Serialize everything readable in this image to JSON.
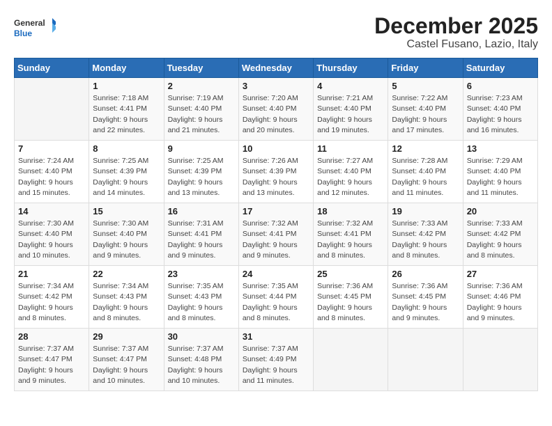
{
  "header": {
    "logo_general": "General",
    "logo_blue": "Blue",
    "month": "December 2025",
    "location": "Castel Fusano, Lazio, Italy"
  },
  "days_of_week": [
    "Sunday",
    "Monday",
    "Tuesday",
    "Wednesday",
    "Thursday",
    "Friday",
    "Saturday"
  ],
  "weeks": [
    [
      {
        "day": "",
        "info": ""
      },
      {
        "day": "1",
        "info": "Sunrise: 7:18 AM\nSunset: 4:41 PM\nDaylight: 9 hours\nand 22 minutes."
      },
      {
        "day": "2",
        "info": "Sunrise: 7:19 AM\nSunset: 4:40 PM\nDaylight: 9 hours\nand 21 minutes."
      },
      {
        "day": "3",
        "info": "Sunrise: 7:20 AM\nSunset: 4:40 PM\nDaylight: 9 hours\nand 20 minutes."
      },
      {
        "day": "4",
        "info": "Sunrise: 7:21 AM\nSunset: 4:40 PM\nDaylight: 9 hours\nand 19 minutes."
      },
      {
        "day": "5",
        "info": "Sunrise: 7:22 AM\nSunset: 4:40 PM\nDaylight: 9 hours\nand 17 minutes."
      },
      {
        "day": "6",
        "info": "Sunrise: 7:23 AM\nSunset: 4:40 PM\nDaylight: 9 hours\nand 16 minutes."
      }
    ],
    [
      {
        "day": "7",
        "info": "Sunrise: 7:24 AM\nSunset: 4:40 PM\nDaylight: 9 hours\nand 15 minutes."
      },
      {
        "day": "8",
        "info": "Sunrise: 7:25 AM\nSunset: 4:39 PM\nDaylight: 9 hours\nand 14 minutes."
      },
      {
        "day": "9",
        "info": "Sunrise: 7:25 AM\nSunset: 4:39 PM\nDaylight: 9 hours\nand 13 minutes."
      },
      {
        "day": "10",
        "info": "Sunrise: 7:26 AM\nSunset: 4:39 PM\nDaylight: 9 hours\nand 13 minutes."
      },
      {
        "day": "11",
        "info": "Sunrise: 7:27 AM\nSunset: 4:40 PM\nDaylight: 9 hours\nand 12 minutes."
      },
      {
        "day": "12",
        "info": "Sunrise: 7:28 AM\nSunset: 4:40 PM\nDaylight: 9 hours\nand 11 minutes."
      },
      {
        "day": "13",
        "info": "Sunrise: 7:29 AM\nSunset: 4:40 PM\nDaylight: 9 hours\nand 11 minutes."
      }
    ],
    [
      {
        "day": "14",
        "info": "Sunrise: 7:30 AM\nSunset: 4:40 PM\nDaylight: 9 hours\nand 10 minutes."
      },
      {
        "day": "15",
        "info": "Sunrise: 7:30 AM\nSunset: 4:40 PM\nDaylight: 9 hours\nand 9 minutes."
      },
      {
        "day": "16",
        "info": "Sunrise: 7:31 AM\nSunset: 4:41 PM\nDaylight: 9 hours\nand 9 minutes."
      },
      {
        "day": "17",
        "info": "Sunrise: 7:32 AM\nSunset: 4:41 PM\nDaylight: 9 hours\nand 9 minutes."
      },
      {
        "day": "18",
        "info": "Sunrise: 7:32 AM\nSunset: 4:41 PM\nDaylight: 9 hours\nand 8 minutes."
      },
      {
        "day": "19",
        "info": "Sunrise: 7:33 AM\nSunset: 4:42 PM\nDaylight: 9 hours\nand 8 minutes."
      },
      {
        "day": "20",
        "info": "Sunrise: 7:33 AM\nSunset: 4:42 PM\nDaylight: 9 hours\nand 8 minutes."
      }
    ],
    [
      {
        "day": "21",
        "info": "Sunrise: 7:34 AM\nSunset: 4:42 PM\nDaylight: 9 hours\nand 8 minutes."
      },
      {
        "day": "22",
        "info": "Sunrise: 7:34 AM\nSunset: 4:43 PM\nDaylight: 9 hours\nand 8 minutes."
      },
      {
        "day": "23",
        "info": "Sunrise: 7:35 AM\nSunset: 4:43 PM\nDaylight: 9 hours\nand 8 minutes."
      },
      {
        "day": "24",
        "info": "Sunrise: 7:35 AM\nSunset: 4:44 PM\nDaylight: 9 hours\nand 8 minutes."
      },
      {
        "day": "25",
        "info": "Sunrise: 7:36 AM\nSunset: 4:45 PM\nDaylight: 9 hours\nand 8 minutes."
      },
      {
        "day": "26",
        "info": "Sunrise: 7:36 AM\nSunset: 4:45 PM\nDaylight: 9 hours\nand 9 minutes."
      },
      {
        "day": "27",
        "info": "Sunrise: 7:36 AM\nSunset: 4:46 PM\nDaylight: 9 hours\nand 9 minutes."
      }
    ],
    [
      {
        "day": "28",
        "info": "Sunrise: 7:37 AM\nSunset: 4:47 PM\nDaylight: 9 hours\nand 9 minutes."
      },
      {
        "day": "29",
        "info": "Sunrise: 7:37 AM\nSunset: 4:47 PM\nDaylight: 9 hours\nand 10 minutes."
      },
      {
        "day": "30",
        "info": "Sunrise: 7:37 AM\nSunset: 4:48 PM\nDaylight: 9 hours\nand 10 minutes."
      },
      {
        "day": "31",
        "info": "Sunrise: 7:37 AM\nSunset: 4:49 PM\nDaylight: 9 hours\nand 11 minutes."
      },
      {
        "day": "",
        "info": ""
      },
      {
        "day": "",
        "info": ""
      },
      {
        "day": "",
        "info": ""
      }
    ]
  ]
}
